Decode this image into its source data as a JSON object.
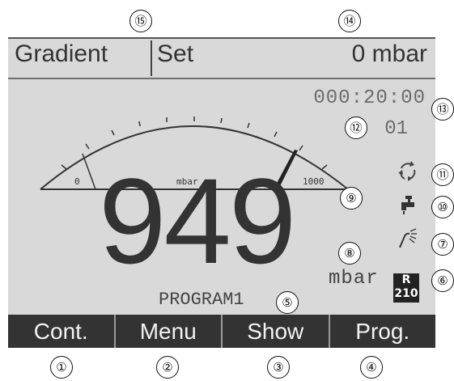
{
  "header": {
    "mode_label": "Gradient",
    "set_label": "Set",
    "pressure_reading": "0 mbar"
  },
  "timer": "000:20:00",
  "step_counter": "01",
  "gauge": {
    "min_label": "0",
    "unit_label": "mbar",
    "max_label": "1000",
    "min": 0,
    "max": 1000,
    "setpoint": 0,
    "value": 949
  },
  "main_value": "949",
  "main_unit": "mbar",
  "program_name": "PROGRAM1",
  "badge": {
    "top": "R",
    "bottom": "210"
  },
  "icons": [
    "cycle-icon",
    "tap-icon",
    "spray-icon",
    "badge-icon"
  ],
  "softkeys": [
    "Cont.",
    "Menu",
    "Show",
    "Prog."
  ],
  "callouts": {
    "c1": "①",
    "c2": "②",
    "c3": "③",
    "c4": "④",
    "c5": "⑤",
    "c6": "⑥",
    "c7": "⑦",
    "c8": "⑧",
    "c9": "⑨",
    "c10": "⑩",
    "c11": "⑪",
    "c12": "⑫",
    "c13": "⑬",
    "c14": "⑭",
    "c15": "⑮"
  }
}
